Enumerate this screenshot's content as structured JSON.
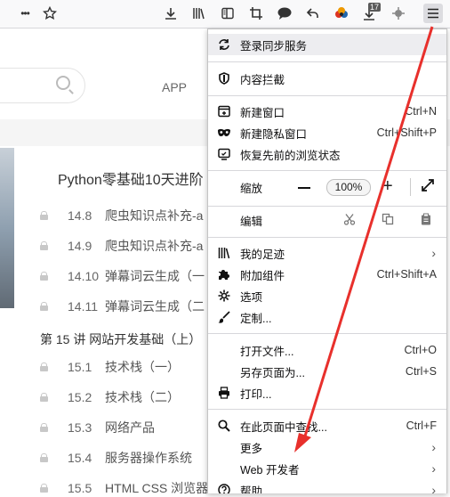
{
  "toolbar": {
    "left_icons": [
      "more-icon",
      "star-icon"
    ],
    "right_icons": [
      "download-icon",
      "library-icon",
      "sidebar-icon",
      "screenshot-icon",
      "chat-icon",
      "back-icon",
      "colorful-icon",
      "downloads-badge-icon",
      "extension-icon",
      "hamburger-menu-icon"
    ],
    "more_glyph": "•••",
    "badge_count": "17"
  },
  "page": {
    "app_label": "APP",
    "course_title": "Python零基础10天进阶",
    "lessons_a": [
      {
        "num": "14.8",
        "title": "爬虫知识点补充-a"
      },
      {
        "num": "14.9",
        "title": "爬虫知识点补充-a"
      },
      {
        "num": "14.10",
        "title": "弹幕词云生成（一"
      },
      {
        "num": "14.11",
        "title": "弹幕词云生成（二"
      }
    ],
    "chapter": "第 15 讲 网站开发基础（上）",
    "lessons_b": [
      {
        "num": "15.1",
        "title": "技术栈（一）"
      },
      {
        "num": "15.2",
        "title": "技术栈（二）"
      },
      {
        "num": "15.3",
        "title": "网络产品"
      },
      {
        "num": "15.4",
        "title": "服务器操作系统"
      },
      {
        "num": "15.5",
        "title": "HTML CSS 浏览器"
      }
    ]
  },
  "menu": {
    "sync": "登录同步服务",
    "blocking": "内容拦截",
    "new_window": {
      "label": "新建窗口",
      "shortcut": "Ctrl+N"
    },
    "new_private": {
      "label": "新建隐私窗口",
      "shortcut": "Ctrl+Shift+P"
    },
    "restore": "恢复先前的浏览状态",
    "zoom_label": "缩放",
    "zoom_value": "100%",
    "zoom_minus": "−",
    "zoom_plus": "+",
    "edit_label": "编辑",
    "library": "我的足迹",
    "addons": {
      "label": "附加组件",
      "shortcut": "Ctrl+Shift+A"
    },
    "options": "选项",
    "customize": "定制...",
    "open_file": {
      "label": "打开文件...",
      "shortcut": "Ctrl+O"
    },
    "save_as": {
      "label": "另存页面为...",
      "shortcut": "Ctrl+S"
    },
    "print": "打印...",
    "find": {
      "label": "在此页面中查找...",
      "shortcut": "Ctrl+F"
    },
    "more": "更多",
    "web_dev": "Web 开发者",
    "help": "帮助",
    "arrow": "›"
  },
  "colors": {
    "arrow": "#e8302c",
    "menu_hover": "#ededf0"
  }
}
